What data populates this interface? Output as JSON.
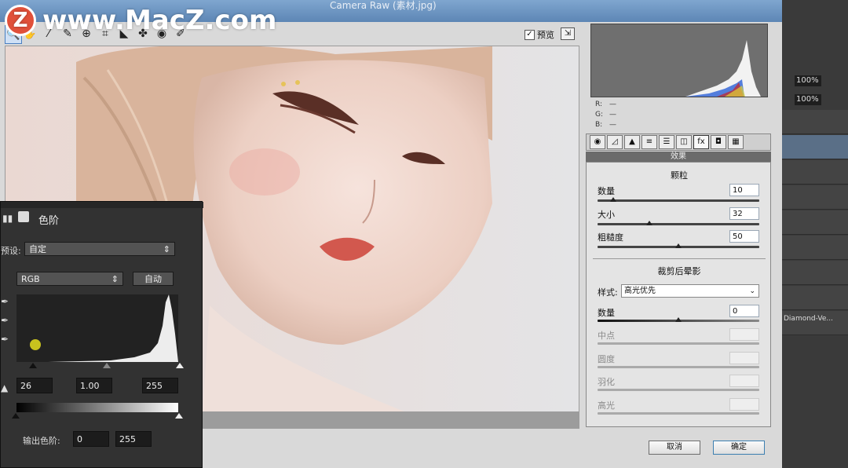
{
  "window": {
    "title": "Camera Raw (素材.jpg)"
  },
  "watermark": {
    "logo_letter": "Z",
    "text": "www.MacZ.com"
  },
  "toolbar": {
    "tools": [
      "zoom-tool",
      "hand-tool",
      "white-balance-tool",
      "color-sampler-tool",
      "target-adjust-tool",
      "crop-tool",
      "straighten-tool",
      "spot-removal-tool",
      "red-eye-tool",
      "adjustment-brush-tool"
    ]
  },
  "preview": {
    "label": "预览",
    "checked": true
  },
  "histogram": {
    "readout": {
      "r": "R:",
      "g": "G:",
      "b": "B:",
      "r_val": "—",
      "g_val": "—",
      "b_val": "—"
    }
  },
  "panel": {
    "header": "效果",
    "grain": {
      "title": "颗粒",
      "amount": {
        "label": "数量",
        "value": "10"
      },
      "size": {
        "label": "大小",
        "value": "32"
      },
      "roughness": {
        "label": "粗糙度",
        "value": "50"
      }
    },
    "vignette": {
      "title": "裁剪后晕影",
      "style": {
        "label": "样式:",
        "value": "高光优先"
      },
      "amount": {
        "label": "数量",
        "value": "0"
      },
      "midpoint": {
        "label": "中点"
      },
      "roundness": {
        "label": "圆度"
      },
      "feather": {
        "label": "羽化"
      },
      "highlights": {
        "label": "高光"
      }
    }
  },
  "buttons": {
    "cancel": "取消",
    "ok": "确定"
  },
  "ps_side": {
    "zoom1": "100%",
    "zoom2": "100%",
    "layer_name": "Diamond-Ve..."
  },
  "levels": {
    "title": "色阶",
    "preset_label": "预设:",
    "preset_value": "自定",
    "channel": "RGB",
    "auto_label": "自动",
    "input_black": "26",
    "input_gamma": "1.00",
    "input_white": "255",
    "output_label": "输出色阶:",
    "output_black": "0",
    "output_white": "255"
  },
  "colors": {
    "accent": "#4a7fc1",
    "title_bar": "#6d95c3",
    "histogram_bg": "#6f6f6f",
    "levels_bg": "#323232"
  }
}
